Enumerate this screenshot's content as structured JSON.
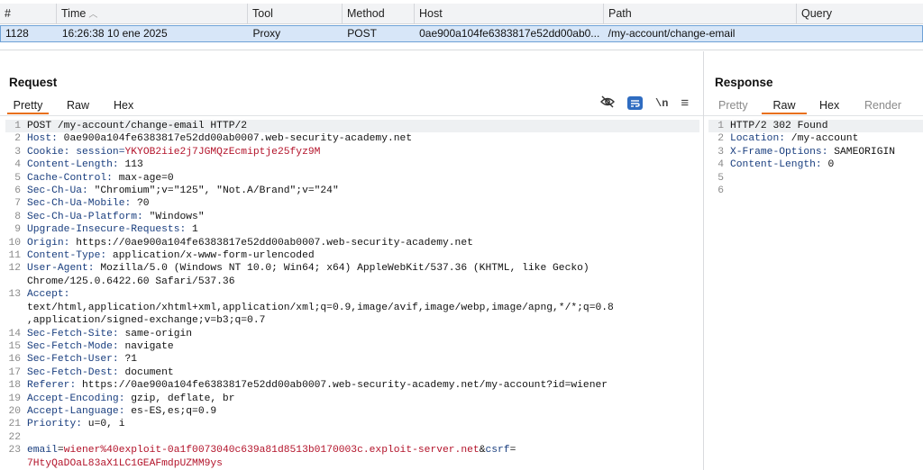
{
  "table": {
    "headers": [
      "#",
      "Time",
      "Tool",
      "Method",
      "Host",
      "Path",
      "Query"
    ],
    "sort_indicator": "^",
    "row": {
      "num": "1128",
      "time": "16:26:38 10 ene 2025",
      "tool": "Proxy",
      "method": "POST",
      "host": "0ae900a104fe6383817e52dd00ab0...",
      "path": "/my-account/change-email",
      "query": ""
    }
  },
  "request": {
    "title": "Request",
    "tabs": [
      "Pretty",
      "Raw",
      "Hex"
    ],
    "active_tab": "Pretty",
    "icons": [
      "eye-slash-icon",
      "wrap-lines-icon",
      "newline-icon",
      "menu-icon"
    ],
    "newline_label": "\\n",
    "menu_label": "≡",
    "lines": [
      {
        "n": "1",
        "k": "",
        "v": "POST /my-account/change-email HTTP/2"
      },
      {
        "n": "2",
        "k": "Host:",
        "v": " 0ae900a104fe6383817e52dd00ab0007.web-security-academy.net"
      },
      {
        "n": "3",
        "k": "Cookie:",
        "v": " session=YKYOB2iie2j7JGMQzEcmiptje25fyz9M"
      },
      {
        "n": "4",
        "k": "Content-Length:",
        "v": " 113"
      },
      {
        "n": "5",
        "k": "Cache-Control:",
        "v": " max-age=0"
      },
      {
        "n": "6",
        "k": "Sec-Ch-Ua:",
        "v": " \"Chromium\";v=\"125\", \"Not.A/Brand\";v=\"24\""
      },
      {
        "n": "7",
        "k": "Sec-Ch-Ua-Mobile:",
        "v": " ?0"
      },
      {
        "n": "8",
        "k": "Sec-Ch-Ua-Platform:",
        "v": " \"Windows\""
      },
      {
        "n": "9",
        "k": "Upgrade-Insecure-Requests:",
        "v": " 1"
      },
      {
        "n": "10",
        "k": "Origin:",
        "v": " https://0ae900a104fe6383817e52dd00ab0007.web-security-academy.net"
      },
      {
        "n": "11",
        "k": "Content-Type:",
        "v": " application/x-www-form-urlencoded"
      },
      {
        "n": "12",
        "k": "User-Agent:",
        "v": " Mozilla/5.0 (Windows NT 10.0; Win64; x64) AppleWebKit/537.36 (KHTML, like Gecko)"
      },
      {
        "n": "",
        "k": "",
        "v": "Chrome/125.0.6422.60 Safari/537.36"
      },
      {
        "n": "13",
        "k": "Accept:",
        "v": ""
      },
      {
        "n": "",
        "k": "",
        "v": "text/html,application/xhtml+xml,application/xml;q=0.9,image/avif,image/webp,image/apng,*/*;q=0.8"
      },
      {
        "n": "",
        "k": "",
        "v": ",application/signed-exchange;v=b3;q=0.7"
      },
      {
        "n": "14",
        "k": "Sec-Fetch-Site:",
        "v": " same-origin"
      },
      {
        "n": "15",
        "k": "Sec-Fetch-Mode:",
        "v": " navigate"
      },
      {
        "n": "16",
        "k": "Sec-Fetch-User:",
        "v": " ?1"
      },
      {
        "n": "17",
        "k": "Sec-Fetch-Dest:",
        "v": " document"
      },
      {
        "n": "18",
        "k": "Referer:",
        "v": " https://0ae900a104fe6383817e52dd00ab0007.web-security-academy.net/my-account?id=wiener"
      },
      {
        "n": "19",
        "k": "Accept-Encoding:",
        "v": " gzip, deflate, br"
      },
      {
        "n": "20",
        "k": "Accept-Language:",
        "v": " es-ES,es;q=0.9"
      },
      {
        "n": "21",
        "k": "Priority:",
        "v": " u=0, i"
      },
      {
        "n": "22",
        "k": "",
        "v": ""
      }
    ],
    "body_line_num": "23",
    "body": {
      "email_key": "email",
      "eq1": "=",
      "email_val": "wiener%40exploit-0a1f0073040c639a81d8513b0170003c.exploit-server.net",
      "amp": "&",
      "csrf_key": "csrf",
      "eq2": "=",
      "csrf_val": "7HtyQaDOaL83aX1LC1GEAFmdpUZMM9ys"
    }
  },
  "response": {
    "title": "Response",
    "tabs": [
      "Pretty",
      "Raw",
      "Hex",
      "Render"
    ],
    "active_tab": "Raw",
    "lines": [
      {
        "n": "1",
        "k": "",
        "v": "HTTP/2 302 Found"
      },
      {
        "n": "2",
        "k": "Location:",
        "v": " /my-account"
      },
      {
        "n": "3",
        "k": "X-Frame-Options:",
        "v": " SAMEORIGIN"
      },
      {
        "n": "4",
        "k": "Content-Length:",
        "v": " 0"
      },
      {
        "n": "5",
        "k": "",
        "v": ""
      },
      {
        "n": "6",
        "k": "",
        "v": ""
      }
    ]
  }
}
